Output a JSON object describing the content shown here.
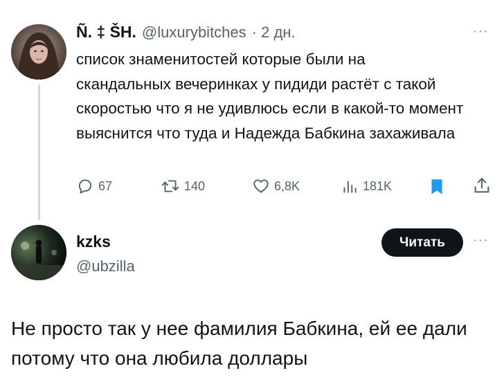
{
  "tweet1": {
    "author_name": "Ñ. ‡ ŠH.",
    "handle": "@luxurybitches",
    "time": "· 2 дн.",
    "text": "список знаменитостей которые были на скандальных вечеринках у пидиди растёт с такой скоростью что я не удивлюсь если в какой-то момент выяснится что туда и Надежда Бабкина захаживала",
    "more": "···",
    "actions": {
      "replies": "67",
      "reposts": "140",
      "likes": "6,8K",
      "views": "181K"
    },
    "colors": {
      "bookmark": "#1d9bf0",
      "icons": "#536471"
    }
  },
  "tweet2": {
    "author_name": "kzks",
    "handle": "@ubzilla",
    "follow_label": "Читать",
    "more": "···",
    "text": "Не просто так у нее фамилия Бабкина, ей ее дали потому что она любила доллары"
  }
}
